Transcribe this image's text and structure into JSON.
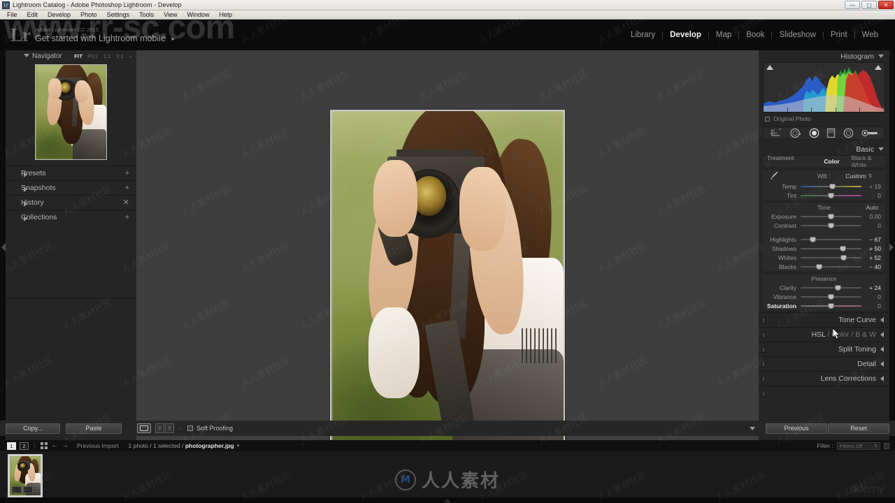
{
  "window": {
    "title": "Lightroom Catalog - Adobe Photoshop Lightroom - Develop",
    "icon": "Lr",
    "buttons": {
      "minimize": "—",
      "maximize": "▢",
      "close": "✕"
    }
  },
  "menubar": {
    "items": [
      "File",
      "Edit",
      "Develop",
      "Photo",
      "Settings",
      "Tools",
      "View",
      "Window",
      "Help"
    ]
  },
  "identity": {
    "logo": "Lr",
    "product": "Adobe Lightroom CC 2015",
    "tagline": "Get started with Lightroom mobile",
    "tagline_arrow": "►"
  },
  "modules": {
    "items": [
      "Library",
      "Develop",
      "Map",
      "Book",
      "Slideshow",
      "Print",
      "Web"
    ],
    "active": "Develop"
  },
  "left_panel": {
    "navigator": {
      "title": "Navigator",
      "zoom_levels": [
        "FIT",
        "FILL",
        "1:1",
        "3:1"
      ],
      "active_zoom": "FIT",
      "dropdown": "⌄"
    },
    "sections": [
      {
        "label": "Presets",
        "action": "+"
      },
      {
        "label": "Snapshots",
        "action": "+"
      },
      {
        "label": "History",
        "action": "✕"
      },
      {
        "label": "Collections",
        "action": "+"
      }
    ]
  },
  "right_panel": {
    "histogram": {
      "title": "Histogram",
      "original_photo_label": "Original Photo",
      "clip_left": "shadow-clip-indicator",
      "clip_right": "highlight-clip-indicator"
    },
    "tools": [
      "crop-overlay-icon",
      "spot-removal-icon",
      "red-eye-icon",
      "graduated-filter-icon",
      "radial-filter-icon",
      "adjustment-brush-icon"
    ],
    "basic": {
      "title": "Basic",
      "treatment_label": "Treatment :",
      "treatment_options": [
        "Color",
        "Black & White"
      ],
      "treatment_active": "Color",
      "wb_label": "WB :",
      "wb_value": "Custom",
      "wb_dropdown": "⇅",
      "white_balance": [
        {
          "name": "Temp",
          "value": "+ 19",
          "pos": 52,
          "track": "temp"
        },
        {
          "name": "Tint",
          "value": "0",
          "pos": 50,
          "track": "tint"
        }
      ],
      "tone_title": "Tone",
      "auto_label": "Auto",
      "tone": [
        {
          "name": "Exposure",
          "value": "0.00",
          "pos": 50,
          "track": "plain"
        },
        {
          "name": "Contrast",
          "value": "0",
          "pos": 50,
          "track": "plain"
        },
        {
          "name": "Highlights",
          "value": "− 67",
          "pos": 20,
          "track": "plain"
        },
        {
          "name": "Shadows",
          "value": "+ 50",
          "pos": 70,
          "track": "plain"
        },
        {
          "name": "Whites",
          "value": "+ 52",
          "pos": 71,
          "track": "plain"
        },
        {
          "name": "Blacks",
          "value": "− 40",
          "pos": 30,
          "track": "plain"
        }
      ],
      "presence_title": "Presence",
      "presence": [
        {
          "name": "Clarity",
          "value": "+ 24",
          "pos": 62,
          "track": "plain"
        },
        {
          "name": "Vibrance",
          "value": "0",
          "pos": 50,
          "track": "plain"
        },
        {
          "name": "Saturation",
          "value": "0",
          "pos": 50,
          "track": "sat"
        }
      ]
    },
    "panels": [
      {
        "label": "Tone Curve",
        "dim": ""
      },
      {
        "label": "HSL",
        "dim": " /  Color  /  B & W"
      },
      {
        "label": "Split Toning",
        "dim": ""
      },
      {
        "label": "Detail",
        "dim": ""
      },
      {
        "label": "Lens Corrections",
        "dim": ""
      }
    ],
    "footer_buttons": [
      "Previous",
      "Reset"
    ]
  },
  "toolbar": {
    "copy_label": "Copy...",
    "paste_label": "Paste",
    "view_icon": "loupe-view-icon",
    "before_after_a": "Y",
    "before_after_b": "Y",
    "dash": "-",
    "soft_proofing_label": "Soft Proofing"
  },
  "filmstrip_header": {
    "source_ids": [
      "1",
      "2"
    ],
    "active_source": "1",
    "grid_icon": "grid-view-icon",
    "back_arrow": "←",
    "forward_arrow": "→",
    "source_label": "Previous Import",
    "selection_info": "1 photo / 1 selected / ",
    "filename": "photographer.jpg",
    "file_dropdown": "▾",
    "filter_label": "Filter :",
    "filter_value": "Filters Off"
  },
  "watermarks": {
    "top_url": "www.rr-sc.com",
    "center_brand": "人人素材",
    "center_mark": "M",
    "udemy": "udemy",
    "tile": "人人素材社区"
  },
  "colors": {
    "panel_bg": "#252525",
    "workspace_bg": "#3e3e3e",
    "accent_text": "#e8e8e8",
    "histogram_red": "#d42a2a",
    "histogram_blue": "#2a5fd4",
    "histogram_yellow": "#e8e02a",
    "histogram_green": "#2ad44a"
  }
}
